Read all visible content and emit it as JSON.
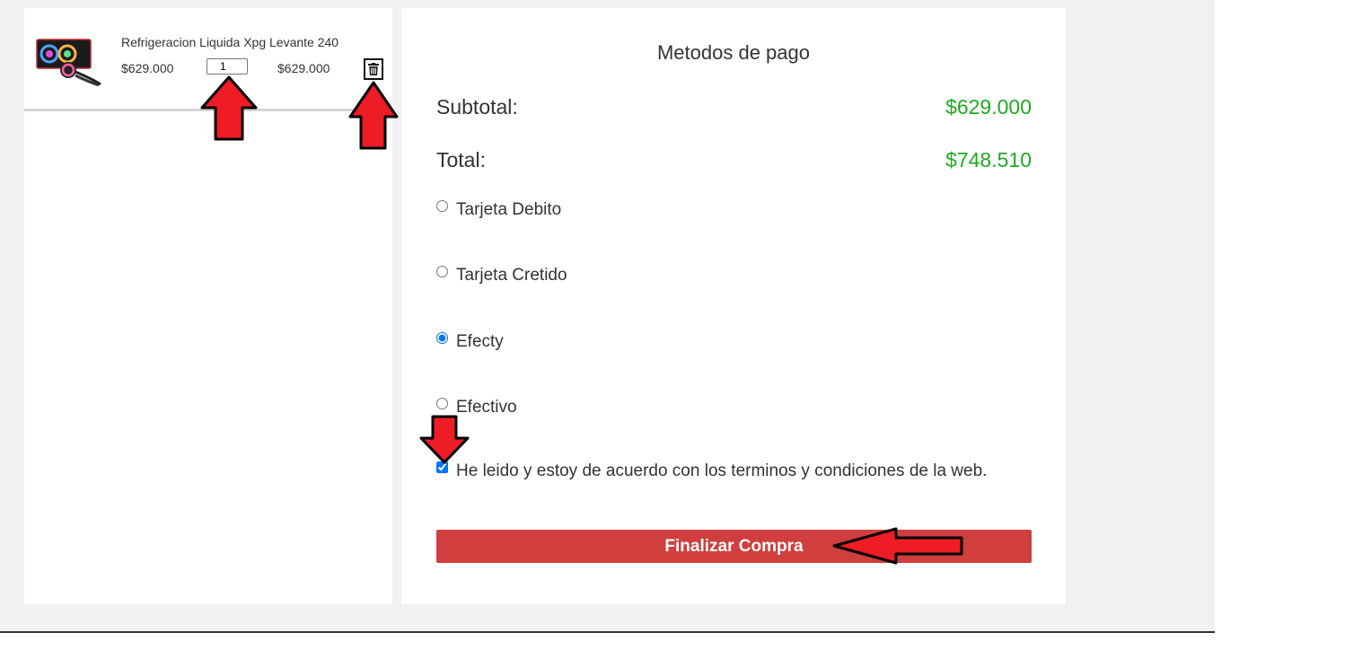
{
  "cart": {
    "product_name": "Refrigeracion Liquida Xpg Levante 240",
    "unit_price": "$629.000",
    "quantity": "1",
    "line_total": "$629.000",
    "delete_icon": "trash-icon"
  },
  "payment": {
    "title": "Metodos de pago",
    "subtotal_label": "Subtotal:",
    "subtotal_value": "$629.000",
    "total_label": "Total:",
    "total_value": "$748.510",
    "options": [
      {
        "label": "Tarjeta Debito",
        "selected": false
      },
      {
        "label": "Tarjeta Cretido",
        "selected": false
      },
      {
        "label": "Efecty",
        "selected": true
      },
      {
        "label": "Efectivo",
        "selected": false
      }
    ],
    "terms_label": "He leido y estoy de acuerdo con los terminos y condiciones de la web.",
    "terms_checked": true,
    "finish_label": "Finalizar Compra"
  },
  "colors": {
    "amount_green": "#1faa1f",
    "button_red": "#d03e3e",
    "annotation_arrow_red": "#ee1c24",
    "page_background": "#f1f1f1"
  }
}
